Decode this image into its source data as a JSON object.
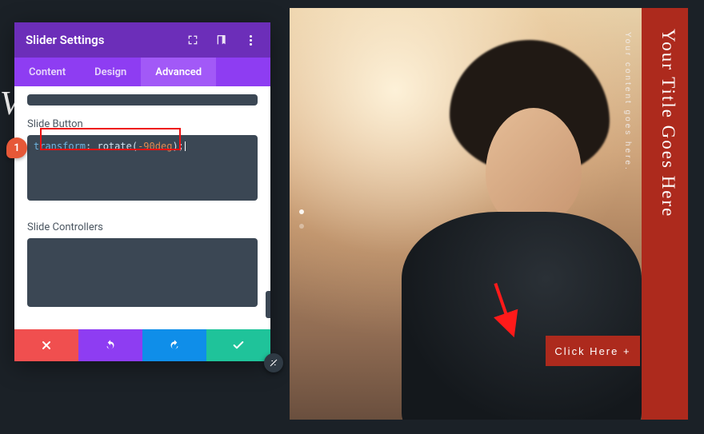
{
  "stray_char": "V",
  "panel": {
    "title": "Slider Settings",
    "tabs": [
      "Content",
      "Design",
      "Advanced"
    ],
    "active_tab": 2,
    "fields": {
      "slide_button_label": "Slide Button",
      "slide_button_code": {
        "kw": "transform",
        "fn": "rotate",
        "arg": "-90deg"
      },
      "slide_controllers_label": "Slide Controllers"
    }
  },
  "badge": "1",
  "preview": {
    "title": "Your Title Goes Here",
    "subtitle": "Your content goes here.",
    "cta": "Click Here +"
  },
  "colors": {
    "accent": "#ad2a1d",
    "purple": "#8e3df2"
  }
}
